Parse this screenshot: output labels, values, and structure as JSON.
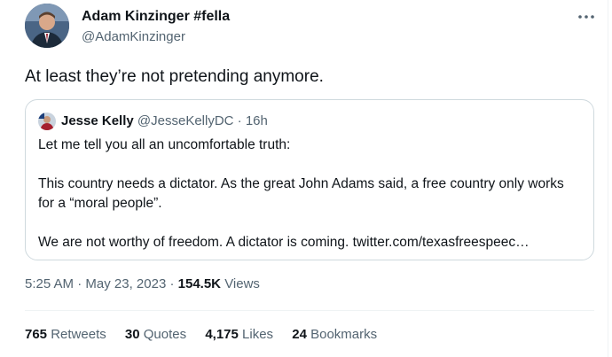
{
  "author": {
    "name": "Adam Kinzinger #fella",
    "handle": "@AdamKinzinger"
  },
  "tweet": {
    "text": "At least they’re not pretending anymore."
  },
  "quote": {
    "name": "Jesse Kelly",
    "handle": "@JesseKellyDC",
    "separator": "·",
    "time": "16h",
    "paragraphs": [
      "Let me tell you all an uncomfortable truth:",
      "This country needs a dictator. As the great John Adams said, a free country only works for a “moral people”.",
      "We are not worthy of freedom. A dictator is coming. twitter.com/texasfreespeec…"
    ]
  },
  "meta": {
    "time": "5:25 AM",
    "sep1": "·",
    "date": "May 23, 2023",
    "sep2": "·",
    "views_count": "154.5K",
    "views_label": "Views"
  },
  "stats": {
    "retweets": {
      "count": "765",
      "label": "Retweets"
    },
    "quotes": {
      "count": "30",
      "label": "Quotes"
    },
    "likes": {
      "count": "4,175",
      "label": "Likes"
    },
    "bookmarks": {
      "count": "24",
      "label": "Bookmarks"
    }
  },
  "icons": {
    "more": "more-horizontal-icon"
  },
  "colors": {
    "text_primary": "#0f1419",
    "text_secondary": "#536471",
    "border": "#cfd9de"
  }
}
